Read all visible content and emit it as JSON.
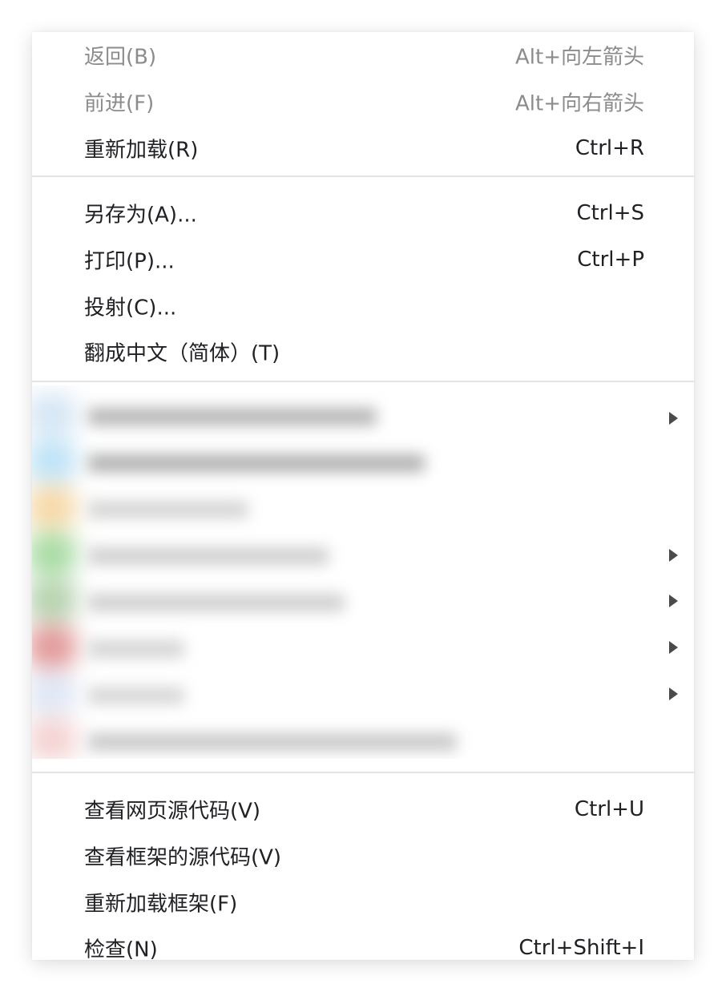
{
  "menu": {
    "items": [
      {
        "label": "返回(B)",
        "shortcut": "Alt+向左箭头",
        "disabled": true
      },
      {
        "label": "前进(F)",
        "shortcut": "Alt+向右箭头",
        "disabled": true
      },
      {
        "label": "重新加载(R)",
        "shortcut": "Ctrl+R",
        "disabled": false
      },
      {
        "label": "另存为(A)...",
        "shortcut": "Ctrl+S",
        "disabled": false
      },
      {
        "label": "打印(P)...",
        "shortcut": "Ctrl+P",
        "disabled": false
      },
      {
        "label": "投射(C)...",
        "shortcut": "",
        "disabled": false
      },
      {
        "label": "翻成中文（简体）(T)",
        "shortcut": "",
        "disabled": false
      },
      {
        "label": "查看网页源代码(V)",
        "shortcut": "Ctrl+U",
        "disabled": false
      },
      {
        "label": "查看框架的源代码(V)",
        "shortcut": "",
        "disabled": false
      },
      {
        "label": "重新加载框架(F)",
        "shortcut": "",
        "disabled": false
      },
      {
        "label": "检查(N)",
        "shortcut": "Ctrl+Shift+I",
        "disabled": false
      }
    ],
    "blurred_icon_colors": [
      "#d6e6f5",
      "#bfe3f7",
      "#f7d9a8",
      "#a9dca4",
      "#b7d3b0",
      "#e39a9a",
      "#dfe7f5",
      "#f5d3d3"
    ]
  }
}
